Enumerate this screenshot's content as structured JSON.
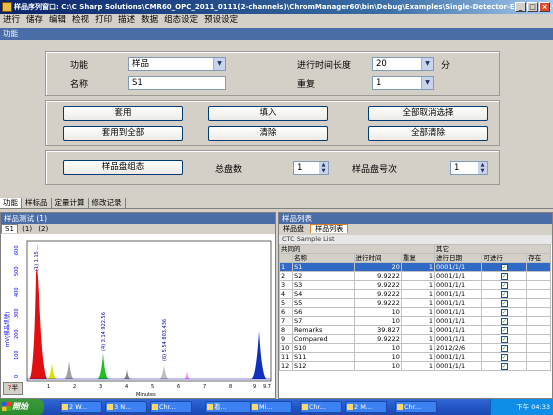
{
  "window": {
    "title": "样品序列窗口: C:\\C Sharp Solutions\\CMR60_OPC_2011_0111(2-channels)\\ChromManager60\\bin\\Debug\\Examples\\Single-Detector-Example_1*"
  },
  "menu": [
    "进行",
    "储存",
    "编辑",
    "检视",
    "打印",
    "描述",
    "数据",
    "组态设定",
    "预设设定"
  ],
  "section_title": "功能",
  "form": {
    "function_label": "功能",
    "function_value": "样品",
    "name_label": "名称",
    "name_value": "S1",
    "runtime_label": "进行时间长度",
    "runtime_value": "20",
    "runtime_unit": "分",
    "repeat_label": "重复",
    "repeat_value": "1"
  },
  "buttons": {
    "apply": "套用",
    "fill": "填入",
    "select_all_cancel": "全部取消选择",
    "apply_all": "套用到全部",
    "clear": "清除",
    "clear_all": "全部清除",
    "tray_config": "样品盘组态"
  },
  "tray": {
    "total_label": "总盘数",
    "total_value": "1",
    "tray_no_label": "样品盘号次",
    "tray_no_value": "1"
  },
  "bottom_tabs": [
    "功能",
    "样标品",
    "定量计算",
    "修改记录"
  ],
  "chrom": {
    "header": "样品测试 (1)",
    "tabs": [
      "S1",
      "(1)",
      "(2)"
    ],
    "ylabel": "mV(樣品訊號)",
    "xlabel": "Minutes",
    "xticks": [
      "1",
      "2",
      "3",
      "4",
      "5",
      "6",
      "7",
      "8",
      "9",
      "9.7"
    ],
    "yticks": [
      "600",
      "500",
      "400",
      "300",
      "200",
      "100",
      "0"
    ],
    "peak_labels": [
      "(1) 1.15 ...",
      "(4) 3.14 922.56",
      "(6) 5.54 803.436"
    ],
    "corner_btn": "半"
  },
  "samplelist": {
    "header": "样品列表",
    "tabs": [
      "样品盘",
      "样品列表"
    ],
    "ctc": "CTC Sample List",
    "group_common": "共同的",
    "group_other": "其它",
    "cols": [
      "名称",
      "进行时间",
      "重复",
      "进行日期",
      "可进行",
      "存在"
    ],
    "rows": [
      {
        "n": "1",
        "name": "S1",
        "time": "20",
        "rep": "1",
        "date": "0001/1/1",
        "ok": true
      },
      {
        "n": "2",
        "name": "S2",
        "time": "9.9222",
        "rep": "1",
        "date": "0001/1/1",
        "ok": true
      },
      {
        "n": "3",
        "name": "S3",
        "time": "9.9222",
        "rep": "1",
        "date": "0001/1/1",
        "ok": true
      },
      {
        "n": "4",
        "name": "S4",
        "time": "9.9222",
        "rep": "1",
        "date": "0001/1/1",
        "ok": true
      },
      {
        "n": "5",
        "name": "S5",
        "time": "9.9222",
        "rep": "1",
        "date": "0001/1/1",
        "ok": true
      },
      {
        "n": "6",
        "name": "S6",
        "time": "10",
        "rep": "1",
        "date": "0001/1/1",
        "ok": true
      },
      {
        "n": "7",
        "name": "S7",
        "time": "10",
        "rep": "1",
        "date": "0001/1/1",
        "ok": true
      },
      {
        "n": "8",
        "name": "Remarks",
        "time": "39.827",
        "rep": "1",
        "date": "0001/1/1",
        "ok": true
      },
      {
        "n": "9",
        "name": "Compared",
        "time": "9.9222",
        "rep": "1",
        "date": "0001/1/1",
        "ok": true
      },
      {
        "n": "10",
        "name": "S10",
        "time": "10",
        "rep": "1",
        "date": "2012/2/6",
        "ok": true
      },
      {
        "n": "11",
        "name": "S11",
        "time": "10",
        "rep": "1",
        "date": "0001/1/1",
        "ok": true
      },
      {
        "n": "12",
        "name": "S12",
        "time": "10",
        "rep": "1",
        "date": "0001/1/1",
        "ok": true
      }
    ]
  },
  "taskbar": {
    "start": "開始",
    "items": [
      "2 W...",
      "3 N...",
      "Chr...",
      "看...",
      "Mi...",
      "Chr...",
      "2 M...",
      "Chr..."
    ],
    "clock": "下午 04:33"
  }
}
